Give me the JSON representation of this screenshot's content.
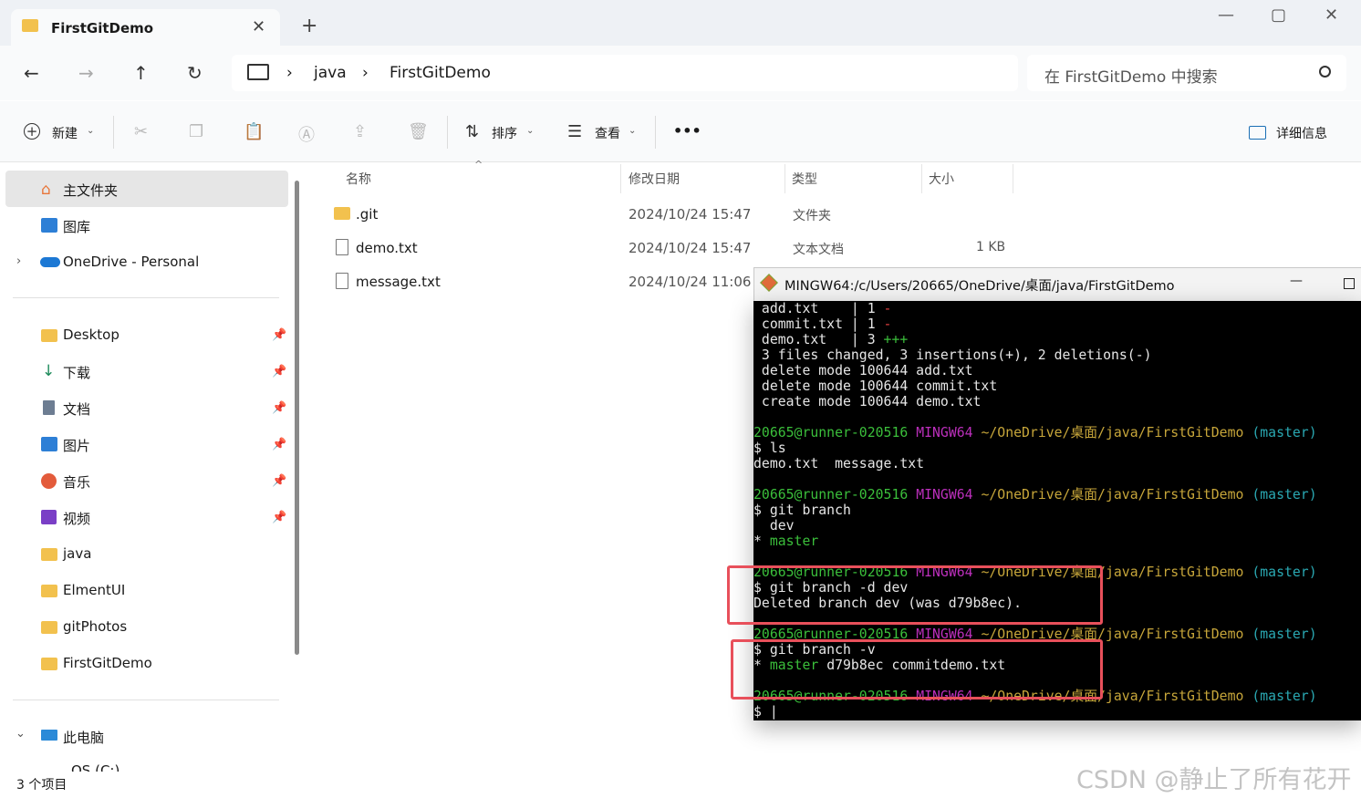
{
  "window": {
    "tab_title": "FirstGitDemo",
    "tab_close": "✕",
    "new_tab": "+",
    "minimize": "—",
    "maximize": "▢",
    "close": "✕"
  },
  "nav": {
    "back": "←",
    "forward": "→",
    "up": "↑",
    "refresh": "↻",
    "breadcrumb": [
      "java",
      "FirstGitDemo"
    ],
    "breadcrumb_sep": "›",
    "search_placeholder": "在 FirstGitDemo 中搜索"
  },
  "toolbar": {
    "new_label": "新建",
    "sort_label": "排序",
    "view_label": "查看",
    "more_label": "•••",
    "details_label": "详细信息"
  },
  "sidebar": {
    "items_top": [
      {
        "label": "主文件夹",
        "icon": "home-icon"
      },
      {
        "label": "图库",
        "icon": "gallery-icon"
      },
      {
        "label": "OneDrive - Personal",
        "icon": "cloud-icon"
      }
    ],
    "pinned": [
      {
        "label": "Desktop",
        "icon": "folder-icon"
      },
      {
        "label": "下载",
        "icon": "download-icon"
      },
      {
        "label": "文档",
        "icon": "document-icon"
      },
      {
        "label": "图片",
        "icon": "picture-icon"
      },
      {
        "label": "音乐",
        "icon": "music-icon"
      },
      {
        "label": "视频",
        "icon": "video-icon"
      }
    ],
    "folders": [
      "java",
      "ElmentUI",
      "gitPhotos",
      "FirstGitDemo"
    ],
    "this_pc": "此电脑",
    "drive_partial": "OS (C:)"
  },
  "file_list": {
    "headers": {
      "name": "名称",
      "modified": "修改日期",
      "type": "类型",
      "size": "大小"
    },
    "rows": [
      {
        "name": ".git",
        "modified": "2024/10/24 15:47",
        "type": "文件夹",
        "size": "",
        "icon": "folder-icon"
      },
      {
        "name": "demo.txt",
        "modified": "2024/10/24 15:47",
        "type": "文本文档",
        "size": "1 KB",
        "icon": "text-file-icon"
      },
      {
        "name": "message.txt",
        "modified": "2024/10/24 11:06",
        "type": "",
        "size": "",
        "icon": "text-file-icon"
      }
    ]
  },
  "status_bar": {
    "count": "3 个项目"
  },
  "terminal": {
    "title": "MINGW64:/c/Users/20665/OneDrive/桌面/java/FirstGitDemo",
    "prompt_user": "20665@runner-020516",
    "prompt_env": "MINGW64",
    "prompt_path": "~/OneDrive/桌面/java/FirstGitDemo",
    "prompt_branch": "(master)",
    "lines": {
      "l1a": " add.txt    | 1 ",
      "l1b": "-",
      "l2a": " commit.txt | 1 ",
      "l2b": "-",
      "l3a": " demo.txt   | 3 ",
      "l3b": "+++",
      "l4": " 3 files changed, 3 insertions(+), 2 deletions(-)",
      "l5": " delete mode 100644 add.txt",
      "l6": " delete mode 100644 commit.txt",
      "l7": " create mode 100644 demo.txt",
      "cmd_ls": "$ ls",
      "out_ls": "demo.txt  message.txt",
      "cmd_branch": "$ git branch",
      "out_dev": "  dev",
      "out_master_star": "* ",
      "out_master": "master",
      "cmd_delete": "$ git branch -d dev",
      "out_delete": "Deleted branch dev (was d79b8ec).",
      "cmd_v": "$ git branch -v",
      "out_v_star": "* ",
      "out_v_master": "master",
      "out_v_rest": " d79b8ec commitdemo.txt",
      "cursor": "$ |"
    }
  },
  "watermark": "CSDN @静止了所有花开"
}
